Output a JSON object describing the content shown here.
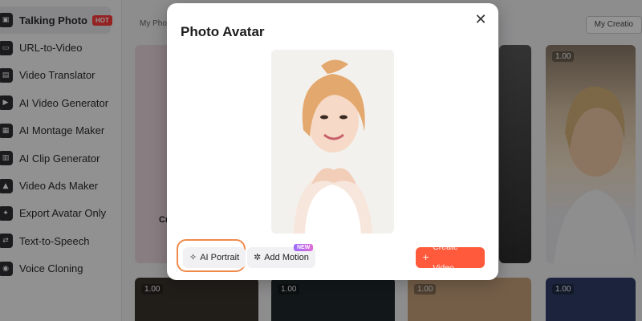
{
  "sidebar": {
    "items": [
      {
        "label": "Talking Photo",
        "icon": "talking-photo-icon",
        "active": true,
        "badge": "HOT"
      },
      {
        "label": "URL-to-Video",
        "icon": "url-icon"
      },
      {
        "label": "Video Translator",
        "icon": "video-translator-icon"
      },
      {
        "label": "AI Video Generator",
        "icon": "ai-video-icon"
      },
      {
        "label": "AI Montage Maker",
        "icon": "montage-icon"
      },
      {
        "label": "AI Clip Generator",
        "icon": "clip-icon"
      },
      {
        "label": "Video Ads Maker",
        "icon": "ads-icon"
      },
      {
        "label": "Export Avatar Only",
        "icon": "export-avatar-icon"
      },
      {
        "label": "Text-to-Speech",
        "icon": "tts-icon"
      },
      {
        "label": "Voice Cloning",
        "icon": "voice-cloning-icon"
      }
    ]
  },
  "main": {
    "tab_label": "My Pho",
    "right_button": "My Creatio",
    "create_card_label": "Cr",
    "card_tags": [
      "1.00",
      "1.00",
      "1.00",
      "1.00",
      "1.00"
    ]
  },
  "modal": {
    "title": "Photo Avatar",
    "close_icon": "close-icon",
    "ai_portrait_label": "AI Portrait",
    "add_motion_label": "Add Motion",
    "new_badge": "NEW",
    "create_video_label": "Create Video",
    "accent_color": "#ff5a3c",
    "highlight_color": "#f08a4b"
  }
}
